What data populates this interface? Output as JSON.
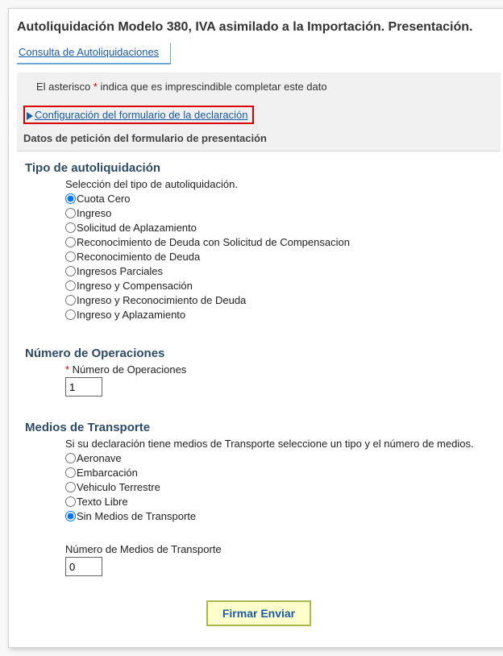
{
  "page_title": "Autoliquidación Modelo 380, IVA asimilado a la Importación. Presentación.",
  "tab_label": "Consulta de Autoliquidaciones",
  "asterisk_prefix": "El asterisco ",
  "asterisk_star": "*",
  "asterisk_suffix": " indica que es imprescindible completar este dato",
  "config_link": "Configuración del formulario de la declaración",
  "section_header": "Datos de petición del formulario de presentación",
  "tipo": {
    "heading": "Tipo de autoliquidación",
    "desc": "Selección del tipo de autoliquidación.",
    "options": [
      "Cuota Cero",
      "Ingreso",
      "Solicitud de Aplazamiento",
      "Reconocimiento de Deuda con Solicitud de Compensacion",
      "Reconocimiento de Deuda",
      "Ingresos Parciales",
      "Ingreso y Compensación",
      "Ingreso y Reconocimiento de Deuda",
      "Ingreso y Aplazamiento"
    ],
    "selected": 0
  },
  "numops": {
    "heading": "Número de Operaciones",
    "label": "Número de Operaciones",
    "value": "1"
  },
  "medios": {
    "heading": "Medios de Transporte",
    "desc": "Si su declaración tiene medios de Transporte seleccione un tipo y el número de medios.",
    "options": [
      "Aeronave",
      "Embarcación",
      "Vehiculo Terrestre",
      "Texto Libre",
      "Sin Medios de Transporte"
    ],
    "selected": 4,
    "num_label": "Número de Medios de Transporte",
    "num_value": "0"
  },
  "submit_label": "Firmar Enviar"
}
